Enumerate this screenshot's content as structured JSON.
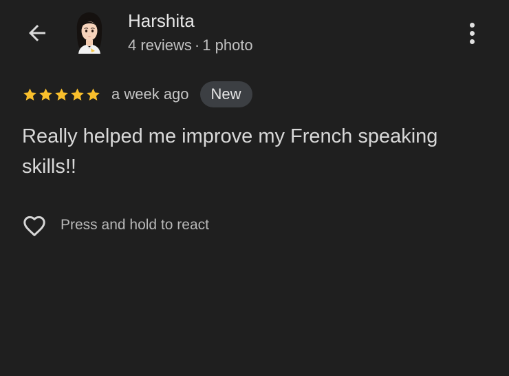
{
  "header": {
    "back_icon": "arrow-back-icon",
    "user_name": "Harshita",
    "reviews_count": "4 reviews",
    "separator": "·",
    "photos_count": "1 photo",
    "more_icon": "more-vertical-icon"
  },
  "review": {
    "rating": 5,
    "rating_max": 5,
    "star_color": "#f9bf2c",
    "date": "a week ago",
    "badge": "New",
    "text": "Really helped me improve my French speaking skills!!"
  },
  "reaction": {
    "icon": "heart-outline-icon",
    "label": "Press and hold to react"
  },
  "theme": {
    "background": "#1f1f1f",
    "badge_background": "#3c3f43"
  }
}
